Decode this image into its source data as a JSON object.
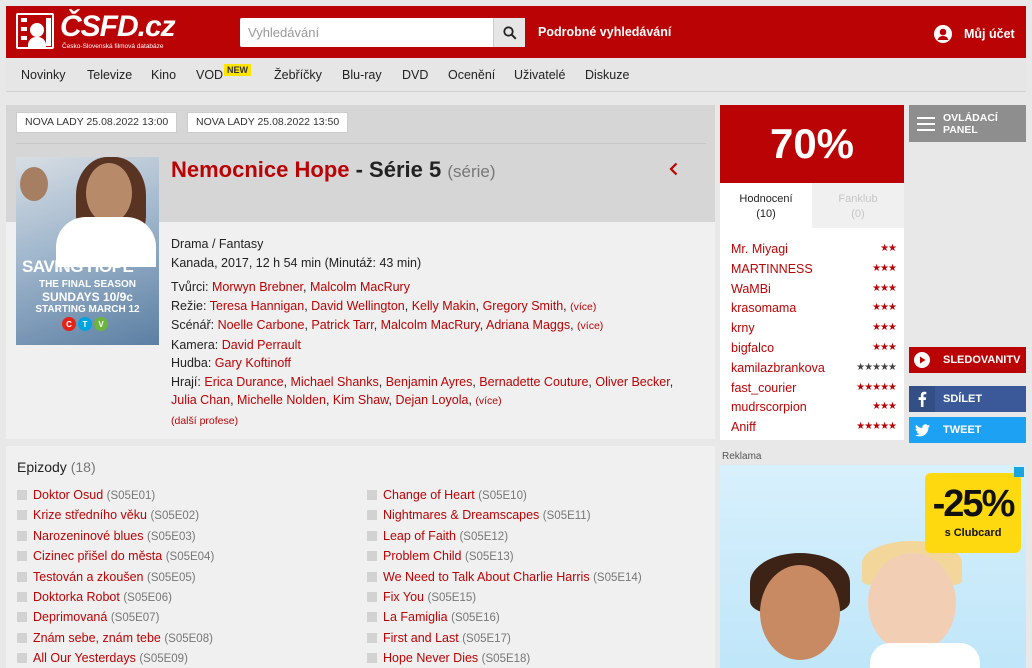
{
  "header": {
    "logo_word": "ČSFD.cz",
    "logo_tagline": "Česko-Slovenská filmová databáze",
    "search_placeholder": "Vyhledávání",
    "advanced_search": "Podrobné vyhledávání",
    "account": "Můj účet"
  },
  "nav": {
    "items": [
      "Novinky",
      "Televize",
      "Kino",
      "VOD",
      "Žebříčky",
      "Blu-ray",
      "DVD",
      "Ocenění",
      "Uživatelé",
      "Diskuze"
    ],
    "vod_badge": "NEW"
  },
  "premieres": [
    "NOVA LADY 25.08.2022 13:00",
    "NOVA LADY 25.08.2022 13:50"
  ],
  "poster": {
    "title": "SAVING HOPE",
    "line1": "THE FINAL SEASON",
    "line2": "SUNDAYS 10/9c",
    "line3": "STARTING MARCH 12"
  },
  "film": {
    "name": "Nemocnice Hope",
    "series": " - Série 5",
    "kind": "(série)",
    "genre": "Drama / Fantasy",
    "origin": "Kanada, 2017, 12 h 54 min (Minutáž: 43 min)",
    "creators_label": "Tvůrci:",
    "creators": [
      "Morwyn Brebner",
      "Malcolm MacRury"
    ],
    "director_label": "Režie:",
    "directors": [
      "Teresa Hannigan",
      "David Wellington",
      "Kelly Makin",
      "Gregory Smith"
    ],
    "script_label": "Scénář:",
    "writers": [
      "Noelle Carbone",
      "Patrick Tarr",
      "Malcolm MacRury",
      "Adriana Maggs"
    ],
    "camera_label": "Kamera:",
    "camera": [
      "David Perrault"
    ],
    "music_label": "Hudba:",
    "music": [
      "Gary Koftinoff"
    ],
    "cast_label": "Hrají:",
    "cast_line1": [
      "Erica Durance",
      "Michael Shanks",
      "Benjamin Ayres",
      "Bernadette Couture",
      "Oliver Becker"
    ],
    "cast_line2": [
      "Julia Chan",
      "Michelle Nolden",
      "Kim Shaw",
      "Dejan Loyola"
    ],
    "more": "(více)",
    "other_professions": "(další profese)"
  },
  "episodes": {
    "title": "Epizody",
    "count": "(18)",
    "items": [
      {
        "name": "Doktor Osud",
        "code": "(S05E01)"
      },
      {
        "name": "Krize středního věku",
        "code": "(S05E02)"
      },
      {
        "name": "Narozeninové blues",
        "code": "(S05E03)"
      },
      {
        "name": "Cizinec přišel do města",
        "code": "(S05E04)"
      },
      {
        "name": "Testován a zkoušen",
        "code": "(S05E05)"
      },
      {
        "name": "Doktorka Robot",
        "code": "(S05E06)"
      },
      {
        "name": "Deprimovaná",
        "code": "(S05E07)"
      },
      {
        "name": "Znám sebe, znám tebe",
        "code": "(S05E08)"
      },
      {
        "name": "All Our Yesterdays",
        "code": "(S05E09)"
      },
      {
        "name": "Change of Heart",
        "code": "(S05E10)"
      },
      {
        "name": "Nightmares & Dreamscapes",
        "code": "(S05E11)"
      },
      {
        "name": "Leap of Faith",
        "code": "(S05E12)"
      },
      {
        "name": "Problem Child",
        "code": "(S05E13)"
      },
      {
        "name": "We Need to Talk About Charlie Harris",
        "code": "(S05E14)"
      },
      {
        "name": "Fix You",
        "code": "(S05E15)"
      },
      {
        "name": "La Famiglia",
        "code": "(S05E16)"
      },
      {
        "name": "First and Last",
        "code": "(S05E17)"
      },
      {
        "name": "Hope Never Dies",
        "code": "(S05E18)"
      }
    ]
  },
  "rating": {
    "percent": "70%",
    "tab_ratings": "Hodnocení",
    "tab_ratings_count": "(10)",
    "tab_fanclub": "Fanklub",
    "tab_fanclub_count": "(0)",
    "users": [
      {
        "name": "Mr. Miyagi",
        "stars": 2,
        "black": false
      },
      {
        "name": "MARTINNESS",
        "stars": 3,
        "black": false
      },
      {
        "name": "WaMBi",
        "stars": 3,
        "black": false
      },
      {
        "name": "krasomama",
        "stars": 3,
        "black": false
      },
      {
        "name": "krny",
        "stars": 3,
        "black": false
      },
      {
        "name": "bigfalco",
        "stars": 3,
        "black": false
      },
      {
        "name": "kamilazbrankova",
        "stars": 5,
        "black": true
      },
      {
        "name": "fast_courier",
        "stars": 5,
        "black": false
      },
      {
        "name": "mudrscorpion",
        "stars": 3,
        "black": false
      },
      {
        "name": "Aniff",
        "stars": 5,
        "black": false
      }
    ]
  },
  "side": {
    "panel": "OVLÁDACÍ PANEL",
    "sledovani": "SLEDOVANITV",
    "share": "SDÍLET",
    "tweet": "TWEET"
  },
  "ad": {
    "label": "Reklama",
    "discount": "-25%",
    "discount_note": "s Clubcard"
  },
  "colors": {
    "brand_red": "#ba0305",
    "facebook": "#3b5998",
    "twitter": "#1da1f2"
  }
}
